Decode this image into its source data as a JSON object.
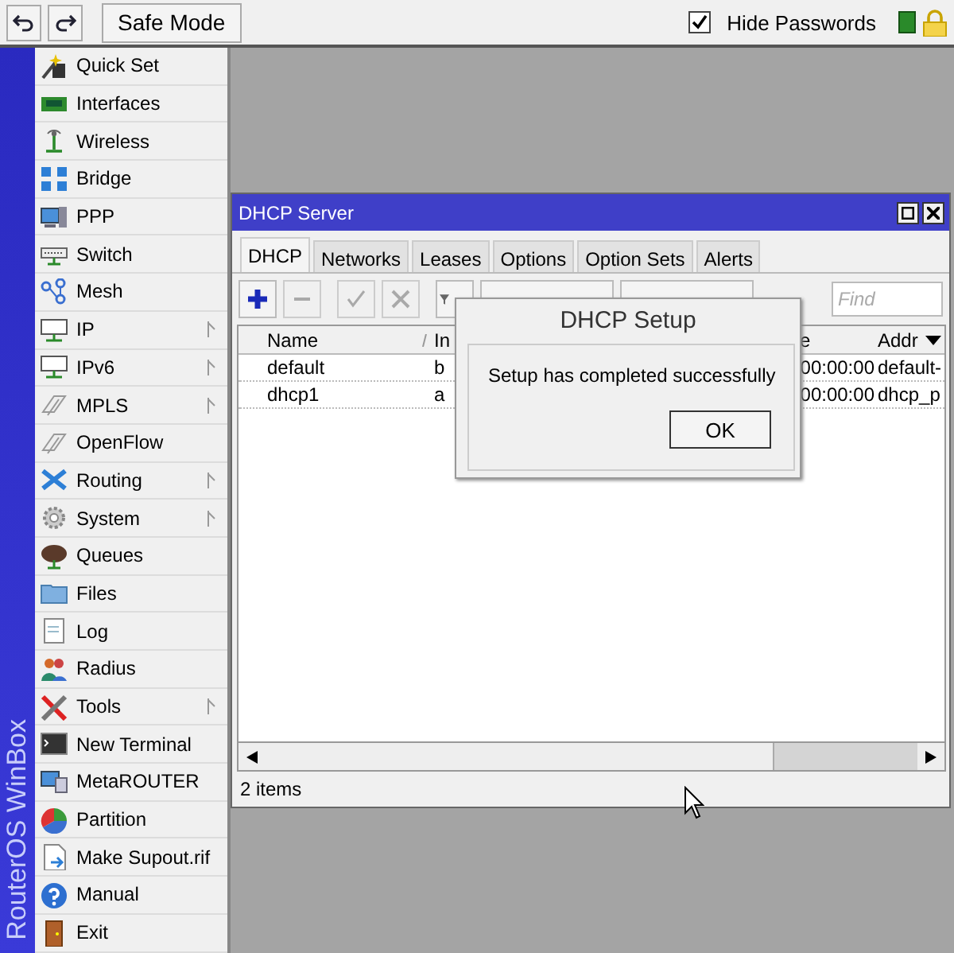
{
  "toolbar": {
    "safe_mode_button": "Safe Mode",
    "hide_passwords": {
      "label": "Hide Passwords",
      "checked": true
    }
  },
  "sidebar": {
    "brand": "RouterOS WinBox",
    "items": [
      {
        "label": "Quick Set",
        "has_submenu": false
      },
      {
        "label": "Interfaces",
        "has_submenu": false
      },
      {
        "label": "Wireless",
        "has_submenu": false
      },
      {
        "label": "Bridge",
        "has_submenu": false
      },
      {
        "label": "PPP",
        "has_submenu": false
      },
      {
        "label": "Switch",
        "has_submenu": false
      },
      {
        "label": "Mesh",
        "has_submenu": false
      },
      {
        "label": "IP",
        "has_submenu": true
      },
      {
        "label": "IPv6",
        "has_submenu": true
      },
      {
        "label": "MPLS",
        "has_submenu": true
      },
      {
        "label": "OpenFlow",
        "has_submenu": false
      },
      {
        "label": "Routing",
        "has_submenu": true
      },
      {
        "label": "System",
        "has_submenu": true
      },
      {
        "label": "Queues",
        "has_submenu": false
      },
      {
        "label": "Files",
        "has_submenu": false
      },
      {
        "label": "Log",
        "has_submenu": false
      },
      {
        "label": "Radius",
        "has_submenu": false
      },
      {
        "label": "Tools",
        "has_submenu": true
      },
      {
        "label": "New Terminal",
        "has_submenu": false
      },
      {
        "label": "MetaROUTER",
        "has_submenu": false
      },
      {
        "label": "Partition",
        "has_submenu": false
      },
      {
        "label": "Make Supout.rif",
        "has_submenu": false
      },
      {
        "label": "Manual",
        "has_submenu": false
      },
      {
        "label": "Exit",
        "has_submenu": false
      }
    ]
  },
  "window": {
    "title": "DHCP Server",
    "tabs": [
      {
        "label": "DHCP",
        "selected": true
      },
      {
        "label": "Networks",
        "selected": false
      },
      {
        "label": "Leases",
        "selected": false
      },
      {
        "label": "Options",
        "selected": false
      },
      {
        "label": "Option Sets",
        "selected": false
      },
      {
        "label": "Alerts",
        "selected": false
      }
    ],
    "tool_buttons": [
      {
        "kind": "add",
        "disabled": false
      },
      {
        "kind": "remove",
        "disabled": true
      },
      {
        "kind": "enable",
        "disabled": true
      },
      {
        "kind": "disable",
        "disabled": true
      },
      {
        "kind": "filter",
        "disabled": false
      }
    ],
    "find": {
      "placeholder": "Find"
    },
    "table": {
      "columns": [
        "Name",
        "In",
        "e",
        "Addr"
      ],
      "rows": [
        [
          "default",
          "b",
          "00:00:00",
          "default-"
        ],
        [
          "dhcp1",
          "a",
          "00:00:00",
          "dhcp_p"
        ]
      ]
    },
    "status_bar": "2 items"
  },
  "dialog": {
    "title": "DHCP Setup",
    "message": "Setup has completed successfully",
    "button": "OK"
  }
}
